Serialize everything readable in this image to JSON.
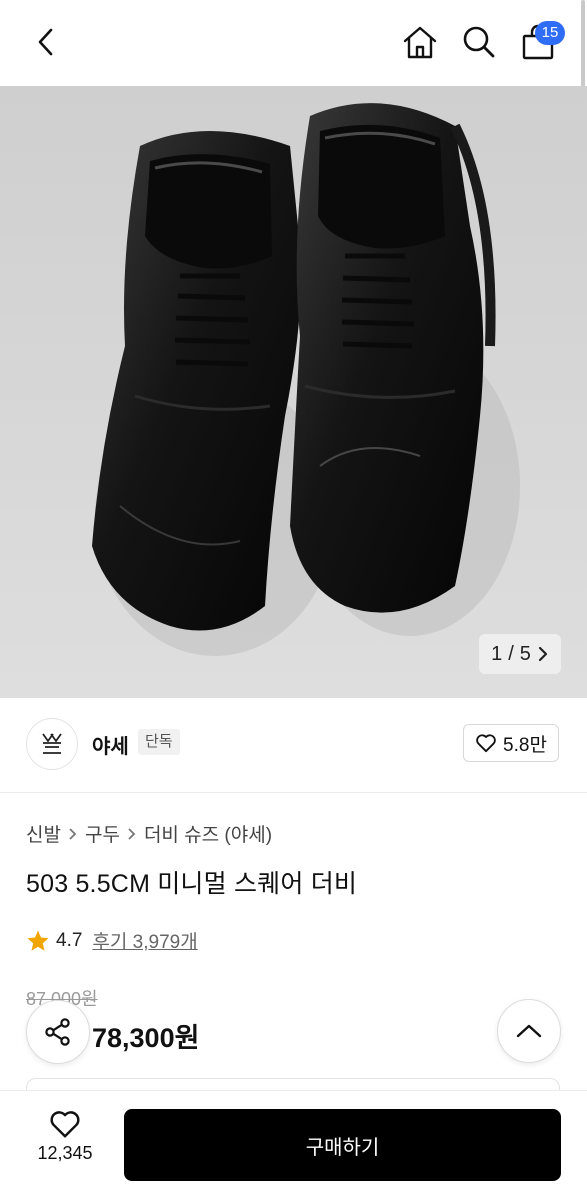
{
  "header": {
    "back_icon": "chevron-left-icon",
    "home_icon": "home-icon",
    "search_icon": "search-icon",
    "cart_icon": "shopping-bag-icon",
    "cart_count": "15",
    "badge_color": "#2f6df6"
  },
  "gallery": {
    "current": "1",
    "separator": "/",
    "total": "5",
    "next_icon": "chevron-right-icon"
  },
  "brand": {
    "logo_icon": "brand-logo",
    "name": "야세",
    "tag": "단독",
    "like_count": "5.8만",
    "like_icon": "heart-outline-icon"
  },
  "breadcrumb": {
    "items": [
      "신발",
      "구두",
      "더비 슈즈 (야세)"
    ],
    "separator_icon": "chevron-right-icon"
  },
  "product": {
    "title": "503 5.5CM 미니멀 스퀘어 더비",
    "rating": "4.7",
    "review_label": "후기 3,979개",
    "original_price": "87,000원",
    "sale_price": "78,300원",
    "star_color": "#f0a500"
  },
  "floating": {
    "share_icon": "share-icon",
    "top_icon": "chevron-up-icon"
  },
  "bottom_bar": {
    "wish_icon": "heart-outline-icon",
    "wish_count": "12,345",
    "buy_label": "구매하기"
  }
}
